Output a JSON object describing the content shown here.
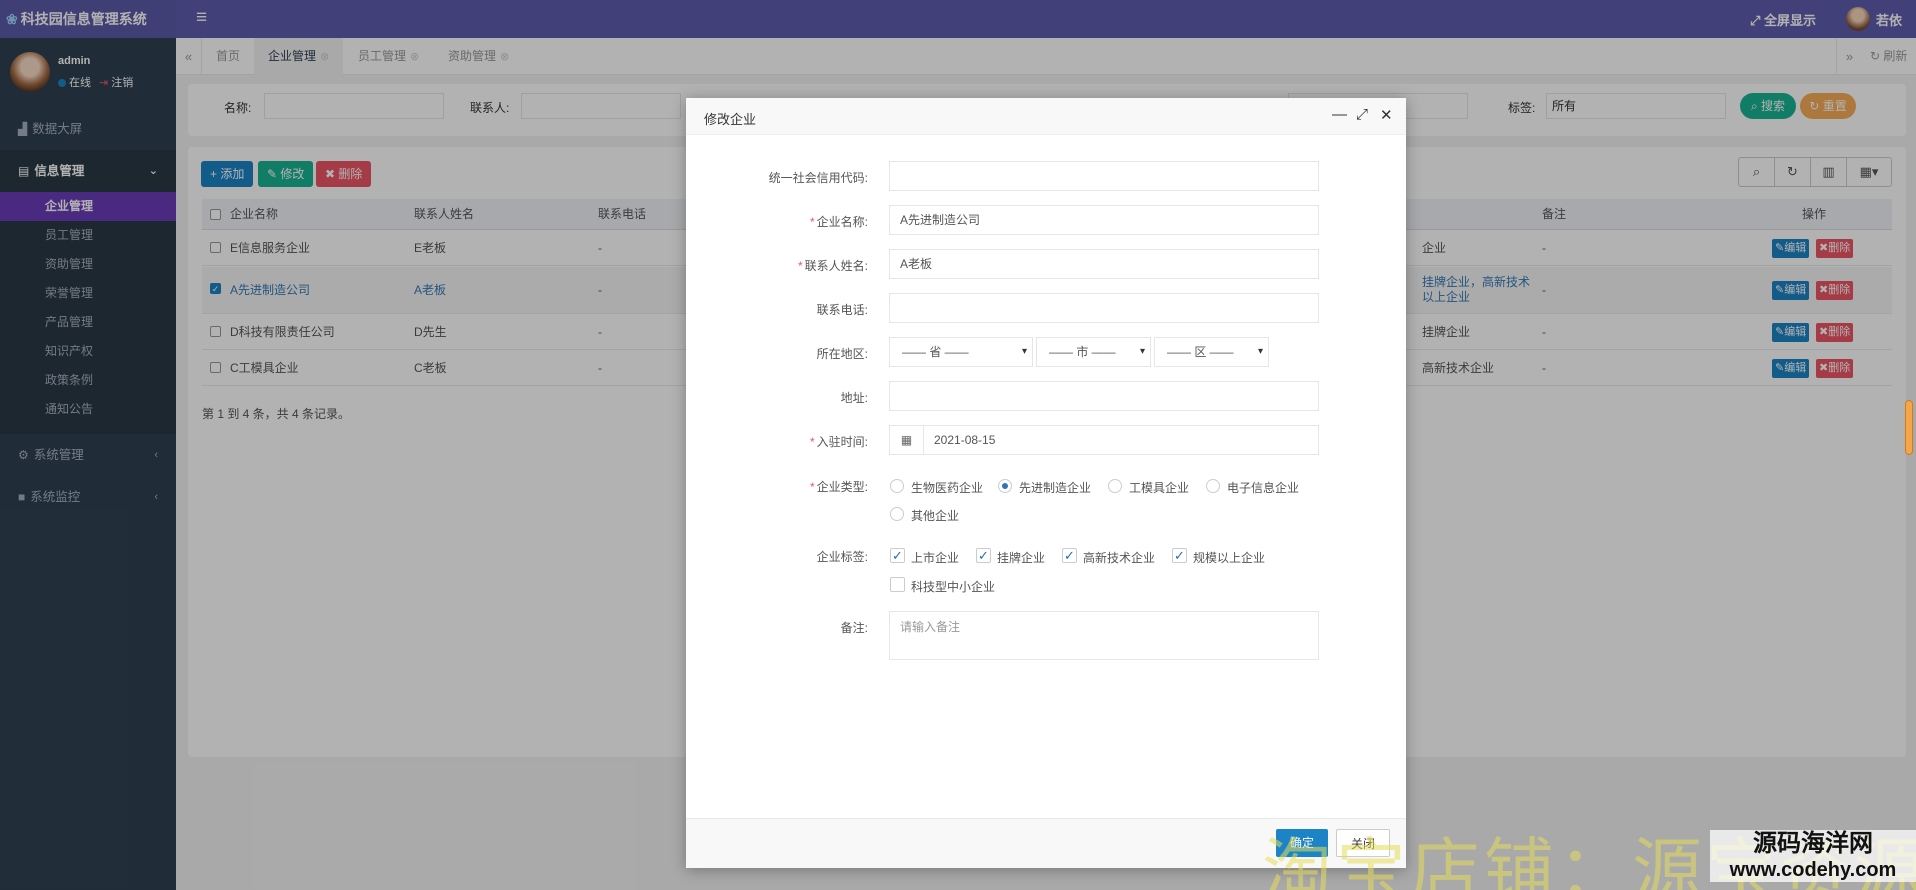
{
  "app": {
    "title": "科技园信息管理系统",
    "logo_icon": "lotus-icon"
  },
  "topbar": {
    "fullscreen_label": "全屏显示",
    "username": "若依"
  },
  "sidebar": {
    "user": {
      "name": "admin",
      "status": "在线",
      "logout": "注销"
    },
    "items": [
      {
        "label": "数据大屏",
        "icon": "chart-icon"
      },
      {
        "label": "信息管理",
        "icon": "card-icon"
      },
      {
        "label": "系统管理",
        "icon": "gear-icon"
      },
      {
        "label": "系统监控",
        "icon": "camera-icon"
      }
    ],
    "sub_items": [
      "企业管理",
      "员工管理",
      "资助管理",
      "荣誉管理",
      "产品管理",
      "知识产权",
      "政策条例",
      "通知公告"
    ]
  },
  "tabs": [
    {
      "label": "首页"
    },
    {
      "label": "企业管理"
    },
    {
      "label": "员工管理"
    },
    {
      "label": "资助管理"
    }
  ],
  "tabbar": {
    "refresh_label": "刷新"
  },
  "search": {
    "name_label": "名称:",
    "contact_label": "联系人:",
    "tag_label": "标签:",
    "tag_value": "所有",
    "search_btn": "搜索",
    "reset_btn": "重置"
  },
  "toolbar": {
    "add": "添加",
    "edit": "修改",
    "delete": "删除"
  },
  "table": {
    "headers": {
      "name": "企业名称",
      "contact": "联系人姓名",
      "phone": "联系电话",
      "remark": "备注",
      "ops": "操作"
    },
    "rows": [
      {
        "name": "E信息服务企业",
        "contact": "E老板",
        "phone": "-",
        "tags": "企业",
        "remark": "-"
      },
      {
        "name": "A先进制造公司",
        "contact": "A老板",
        "phone": "-",
        "tags": "挂牌企业，高新技术",
        "tags2": "以上企业",
        "remark": "-"
      },
      {
        "name": "D科技有限责任公司",
        "contact": "D先生",
        "phone": "-",
        "tags": "挂牌企业",
        "remark": "-"
      },
      {
        "name": "C工模具企业",
        "contact": "C老板",
        "phone": "-",
        "tags": "高新技术企业",
        "remark": "-"
      }
    ],
    "edit_label": "编辑",
    "delete_label": "删除",
    "page_info": "第 1 到 4 条，共 4 条记录。"
  },
  "modal": {
    "title": "修改企业",
    "labels": {
      "credit_code": "统一社会信用代码:",
      "company_name": "企业名称:",
      "contact_name": "联系人姓名:",
      "phone": "联系电话:",
      "region": "所在地区:",
      "address": "地址:",
      "entry_time": "入驻时间:",
      "company_type": "企业类型:",
      "company_tags": "企业标签:",
      "remark": "备注:"
    },
    "values": {
      "credit_code": "",
      "company_name": "A先进制造公司",
      "contact_name": "A老板",
      "phone": "",
      "address": "",
      "entry_time": "2021-08-15"
    },
    "region": {
      "province": "—— 省 ——",
      "city": "—— 市 ——",
      "district": "—— 区 ——"
    },
    "types": [
      {
        "label": "生物医药企业",
        "selected": false
      },
      {
        "label": "先进制造企业",
        "selected": true
      },
      {
        "label": "工模具企业",
        "selected": false
      },
      {
        "label": "电子信息企业",
        "selected": false
      },
      {
        "label": "其他企业",
        "selected": false
      }
    ],
    "tags": [
      {
        "label": "上市企业",
        "checked": true
      },
      {
        "label": "挂牌企业",
        "checked": true
      },
      {
        "label": "高新技术企业",
        "checked": true
      },
      {
        "label": "规模以上企业",
        "checked": true
      },
      {
        "label": "科技型中小企业",
        "checked": false
      }
    ],
    "remark_placeholder": "请输入备注",
    "ok": "确定",
    "close": "关闭"
  },
  "watermark": {
    "text": "淘宝店铺：源宝资源",
    "site_name": "源码海洋网",
    "site_url": "www.codehy.com"
  }
}
